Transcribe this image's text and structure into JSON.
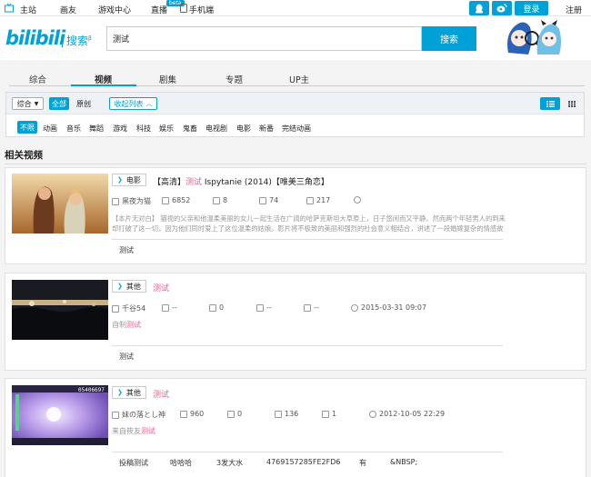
{
  "topnav": {
    "items": [
      "主站",
      "画友",
      "游戏中心",
      "直播",
      "手机端"
    ],
    "beta": "beta",
    "login": "登录",
    "register": "注册"
  },
  "header": {
    "logo": "bilibili",
    "logo_sub": "搜索",
    "logo_sup": "β",
    "search_value": "测试",
    "search_button": "搜索"
  },
  "tabs": [
    "综合",
    "视频",
    "剧集",
    "专题",
    "UP主"
  ],
  "filters": {
    "sort": "综合",
    "all": "全部",
    "original": "原创",
    "collapse": "收起列表",
    "categories": [
      "不限",
      "动画",
      "音乐",
      "舞蹈",
      "游戏",
      "科技",
      "娱乐",
      "鬼畜",
      "电视剧",
      "电影",
      "新番",
      "完结动画"
    ]
  },
  "section_title": "相关视频",
  "results": [
    {
      "tag": "电影",
      "title_pre": "【高清】",
      "title_hl": "测试",
      "title_post": " Ispytanie (2014)【唯美三角恋】",
      "uploader": "黑夜为猫",
      "plays": "6852",
      "danmaku": "8",
      "favorites": "74",
      "reviews": "217",
      "date": "",
      "desc_line1": "【本片无对白】 猫视的父亲和他温柔美丽的女儿一起生活在广阔的哈萨克斯坦大草原上，日子悠闲而又平静。然而两个年轻男人的到来",
      "desc_line2": "却打破了这一切，因为他们同时爱上了这位温柔的姑娘。影片将不极致的美丽和强烈的社会意义相结合，讲述了一段婚嫁复杂的情感故",
      "keywords": [
        "测试"
      ]
    },
    {
      "tag": "其他",
      "title_pre": "",
      "title_hl": "测试",
      "title_post": "",
      "uploader": "千谷54",
      "plays": "--",
      "danmaku": "0",
      "favorites": "--",
      "reviews": "--",
      "date": "2015-03-31 09:07",
      "desc_pre": "自制 ",
      "desc_hl": "测试",
      "keywords": [
        "测试"
      ]
    },
    {
      "tag": "其他",
      "title_pre": "",
      "title_hl": "测试",
      "title_post": "",
      "uploader": "妹の落とし神",
      "plays": "960",
      "danmaku": "0",
      "favorites": "136",
      "reviews": "1",
      "date": "2012-10-05 22:29",
      "desc_pre": "来自筱友 ",
      "desc_hl": "测试",
      "thumb_text": "05406697",
      "keywords": [
        "投稿测试",
        "哈哈哈",
        "3发大水",
        "4769157285FE2FD6",
        "有",
        "&NBSP;"
      ]
    }
  ],
  "colors": {
    "accent": "#00a1d6",
    "highlight": "#f25d8e"
  }
}
